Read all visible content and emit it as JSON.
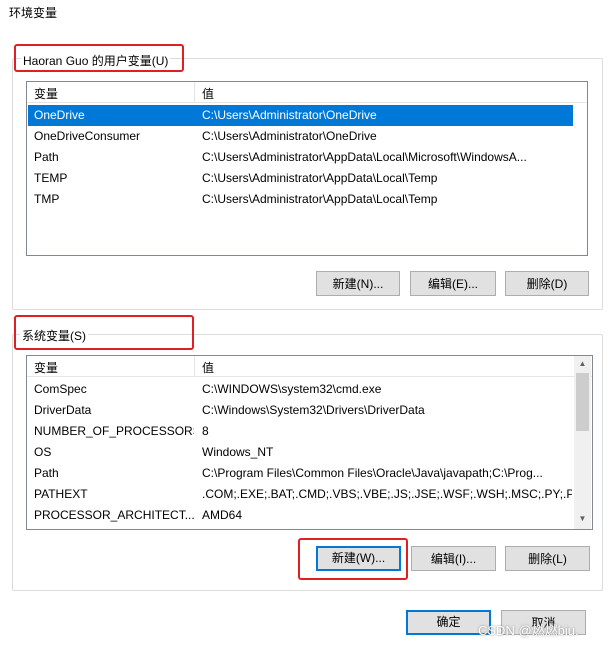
{
  "window": {
    "title": "环境变量"
  },
  "user_group": {
    "label": "Haoran Guo 的用户变量(U)",
    "columns": [
      "变量",
      "值"
    ],
    "rows": [
      {
        "name": "OneDrive",
        "value": "C:\\Users\\Administrator\\OneDrive"
      },
      {
        "name": "OneDriveConsumer",
        "value": "C:\\Users\\Administrator\\OneDrive"
      },
      {
        "name": "Path",
        "value": "C:\\Users\\Administrator\\AppData\\Local\\Microsoft\\WindowsA..."
      },
      {
        "name": "TEMP",
        "value": "C:\\Users\\Administrator\\AppData\\Local\\Temp"
      },
      {
        "name": "TMP",
        "value": "C:\\Users\\Administrator\\AppData\\Local\\Temp"
      }
    ],
    "buttons": {
      "new": "新建(N)...",
      "edit": "编辑(E)...",
      "delete": "删除(D)"
    }
  },
  "system_group": {
    "label": "系统变量(S)",
    "columns": [
      "变量",
      "值"
    ],
    "rows": [
      {
        "name": "ComSpec",
        "value": "C:\\WINDOWS\\system32\\cmd.exe"
      },
      {
        "name": "DriverData",
        "value": "C:\\Windows\\System32\\Drivers\\DriverData"
      },
      {
        "name": "NUMBER_OF_PROCESSORS",
        "value": "8"
      },
      {
        "name": "OS",
        "value": "Windows_NT"
      },
      {
        "name": "Path",
        "value": "C:\\Program Files\\Common Files\\Oracle\\Java\\javapath;C:\\Prog..."
      },
      {
        "name": "PATHEXT",
        "value": ".COM;.EXE;.BAT;.CMD;.VBS;.VBE;.JS;.JSE;.WSF;.WSH;.MSC;.PY;.P..."
      },
      {
        "name": "PROCESSOR_ARCHITECT...",
        "value": "AMD64"
      }
    ],
    "buttons": {
      "new": "新建(W)...",
      "edit": "编辑(I)...",
      "delete": "删除(L)"
    }
  },
  "footer": {
    "ok": "确定",
    "cancel": "取消"
  },
  "watermark": "CSDN @燃燃biu.",
  "colors": {
    "selection": "#0078d7",
    "highlight_box": "#e02020"
  }
}
